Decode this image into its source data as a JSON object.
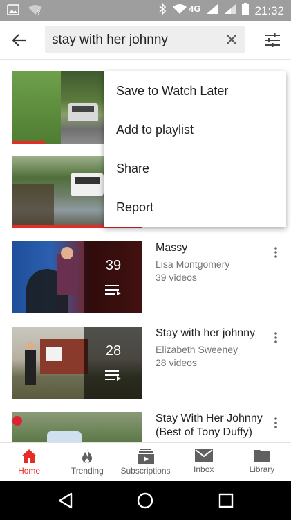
{
  "status_bar": {
    "network": "4G",
    "time": "21:32"
  },
  "search": {
    "query": "stay with her johnny"
  },
  "context_menu": {
    "items": [
      "Save to Watch Later",
      "Add to playlist",
      "Share",
      "Report"
    ]
  },
  "results": [
    {
      "type": "video",
      "progress": 0.25
    },
    {
      "type": "video",
      "progress": 1.0
    },
    {
      "type": "playlist",
      "title": "Massy",
      "channel": "Lisa Montgomery",
      "count_label": "39 videos",
      "count": "39"
    },
    {
      "type": "playlist",
      "title": "Stay with her johnny",
      "channel": "Elizabeth Sweeney",
      "count_label": "28 videos",
      "count": "28"
    },
    {
      "type": "video",
      "title": "Stay With Her Johnny (Best of Tony Duffy)"
    }
  ],
  "bottom_nav": {
    "items": [
      {
        "label": "Home",
        "icon": "home-icon",
        "active": true
      },
      {
        "label": "Trending",
        "icon": "flame-icon"
      },
      {
        "label": "Subscriptions",
        "icon": "subscriptions-icon"
      },
      {
        "label": "Inbox",
        "icon": "inbox-icon"
      },
      {
        "label": "Library",
        "icon": "folder-icon"
      }
    ]
  },
  "colors": {
    "accent": "#e52d27",
    "status_bar": "#9e9e9e",
    "text_secondary": "#757575"
  }
}
